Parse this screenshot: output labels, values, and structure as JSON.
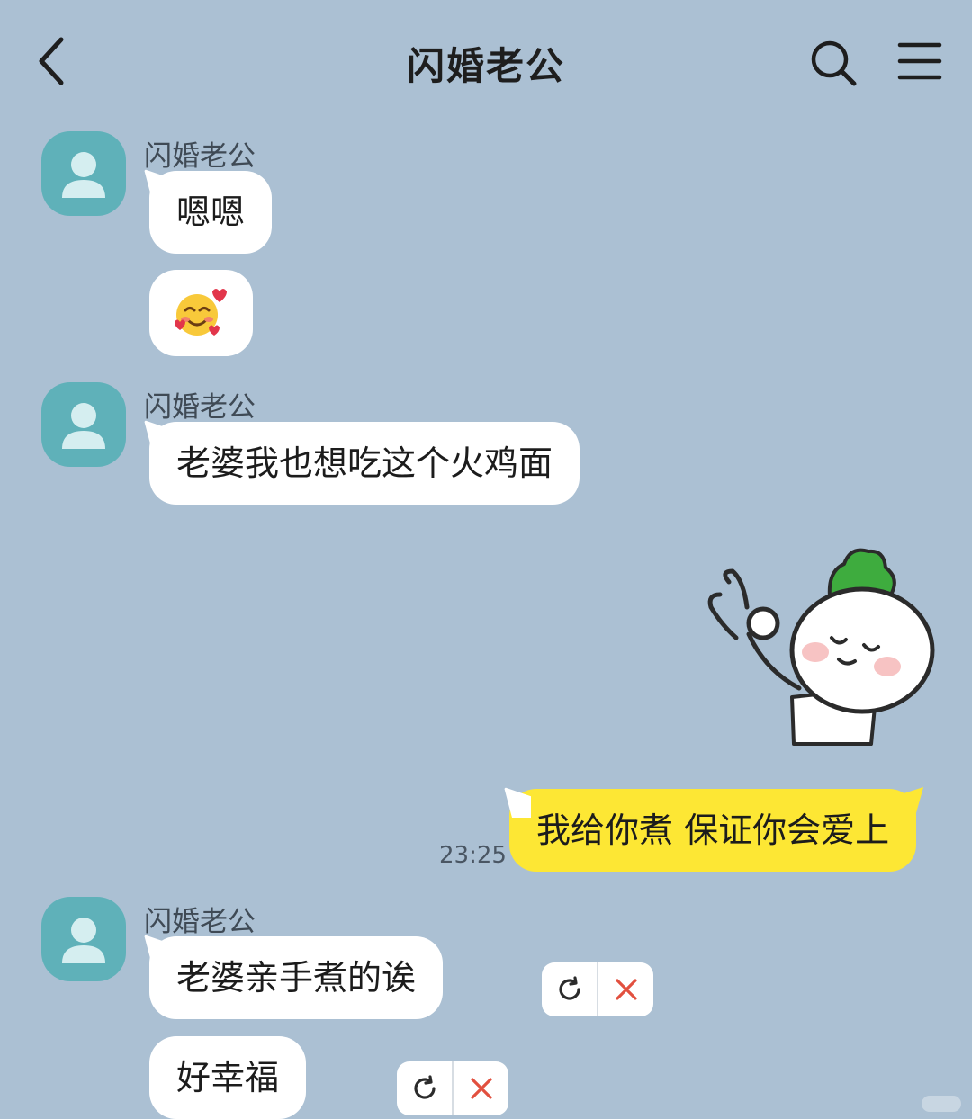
{
  "header": {
    "title": "闪婚老公",
    "back_icon": "chevron-left-icon",
    "search_icon": "search-icon",
    "menu_icon": "hamburger-menu-icon"
  },
  "messages": [
    {
      "sender": "闪婚老公",
      "texts": [
        "嗯嗯",
        "🥰"
      ]
    },
    {
      "sender": "闪婚老公",
      "texts": [
        "老婆我也想吃这个火鸡面"
      ]
    },
    {
      "from_me": true,
      "sticker": "radish-ok-sticker",
      "text": "我给你煮 保证你会爱上",
      "time": "23:25"
    },
    {
      "sender": "闪婚老公",
      "texts": [
        "老婆亲手煮的诶",
        "好幸福"
      ],
      "status": "failed"
    }
  ],
  "colors": {
    "background": "#abc0d3",
    "my_bubble": "#fde734",
    "their_bubble": "#ffffff",
    "avatar": "#5fb1b9",
    "error": "#e2503f"
  }
}
